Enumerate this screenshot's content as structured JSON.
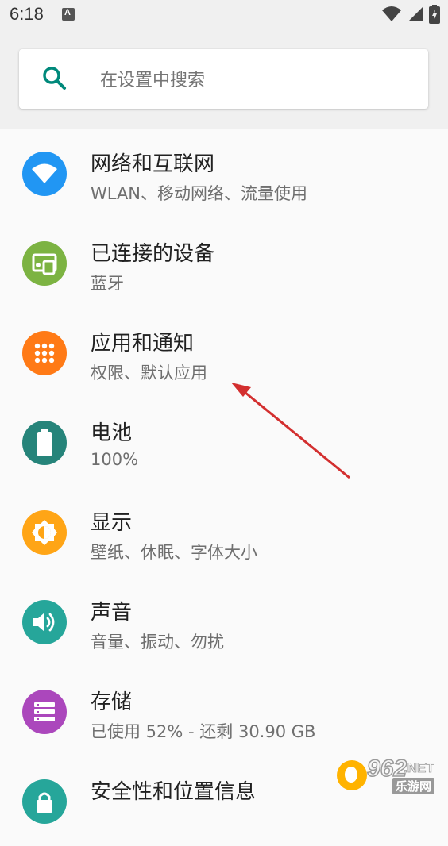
{
  "status_bar": {
    "time": "6:18",
    "notification_icon": "a-badge-icon",
    "icons": [
      "wifi-icon",
      "cellular-signal-icon",
      "battery-charging-icon"
    ]
  },
  "search": {
    "placeholder": "在设置中搜索",
    "icon": "search-icon"
  },
  "settings_items": [
    {
      "title": "网络和互联网",
      "subtitle": "WLAN、移动网络、流量使用",
      "icon": "wifi-icon",
      "color": "#2196f3"
    },
    {
      "title": "已连接的设备",
      "subtitle": "蓝牙",
      "icon": "devices-icon",
      "color": "#7cb342"
    },
    {
      "title": "应用和通知",
      "subtitle": "权限、默认应用",
      "icon": "apps-grid-icon",
      "color": "#ff7a16"
    },
    {
      "title": "电池",
      "subtitle": "100%",
      "icon": "battery-icon",
      "color": "#26847a"
    },
    {
      "title": "显示",
      "subtitle": "壁纸、休眠、字体大小",
      "icon": "brightness-icon",
      "color": "#ffa516"
    },
    {
      "title": "声音",
      "subtitle": "音量、振动、勿扰",
      "icon": "volume-icon",
      "color": "#26a69a"
    },
    {
      "title": "存储",
      "subtitle": "已使用 52% - 还剩 30.90 GB",
      "icon": "storage-icon",
      "color": "#ab47bc"
    },
    {
      "title": "安全性和位置信息",
      "subtitle": "",
      "icon": "lock-icon",
      "color": "#26a69a"
    }
  ],
  "annotation": {
    "type": "red-arrow",
    "points_to": "应用和通知"
  },
  "watermark": {
    "number": "962",
    "suffix": ".NET",
    "site": "乐游网"
  },
  "colors": {
    "accent": "#00897b",
    "arrow": "#d32f2f",
    "background": "#fafafa"
  }
}
